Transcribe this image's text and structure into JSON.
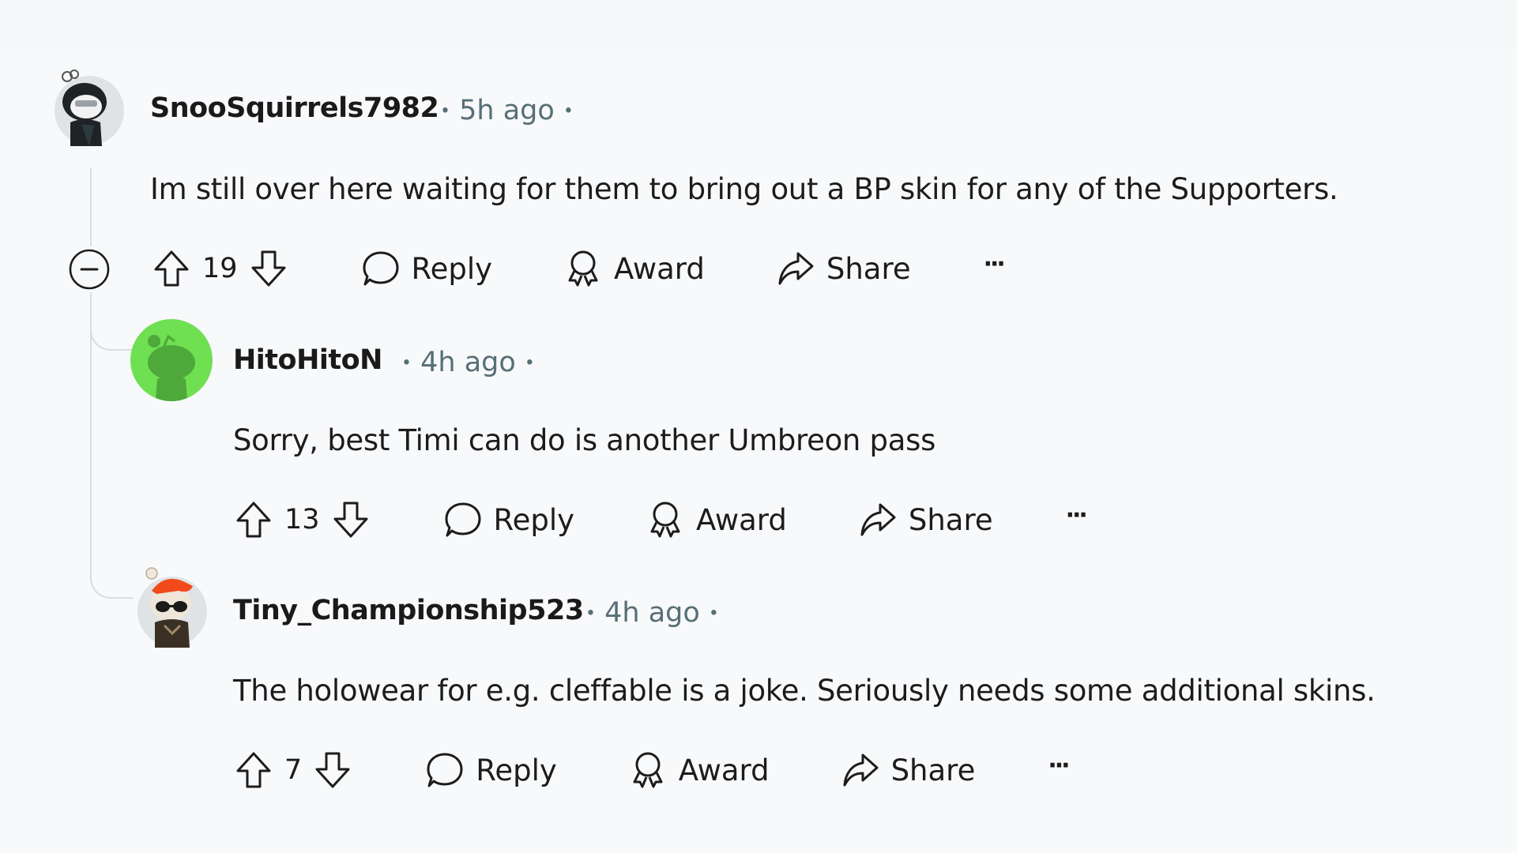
{
  "comments": [
    {
      "username": "SnooSquirrels7982",
      "time": "5h ago",
      "body": "Im still over here waiting for them to bring out a BP skin for any of the Supporters.",
      "votes": "19",
      "avatar": "snoo-avatar-dark-hood",
      "actions": {
        "reply": "Reply",
        "award": "Award",
        "share": "Share",
        "more": "···"
      }
    },
    {
      "username": "HitoHitoN",
      "time": "4h ago",
      "body": "Sorry, best Timi can do is another Umbreon pass",
      "votes": "13",
      "avatar": "default-snoo-green",
      "avatar_color": "#6ee052",
      "actions": {
        "reply": "Reply",
        "award": "Award",
        "share": "Share",
        "more": "···"
      }
    },
    {
      "username": "Tiny_Championship523",
      "time": "4h ago",
      "body": "The holowear for e.g. cleffable is a joke. Seriously needs some additional skins.",
      "votes": "7",
      "avatar": "snoo-avatar-orange-cap-sunglasses",
      "actions": {
        "reply": "Reply",
        "award": "Award",
        "share": "Share",
        "more": "···"
      }
    }
  ],
  "separator": "•",
  "icons": {
    "collapse": "minus-circle-icon",
    "upvote": "arrow-up-icon",
    "downvote": "arrow-down-icon",
    "reply": "comment-bubble-icon",
    "award": "award-ribbon-icon",
    "share": "share-arrow-icon",
    "more": "ellipsis-icon"
  }
}
